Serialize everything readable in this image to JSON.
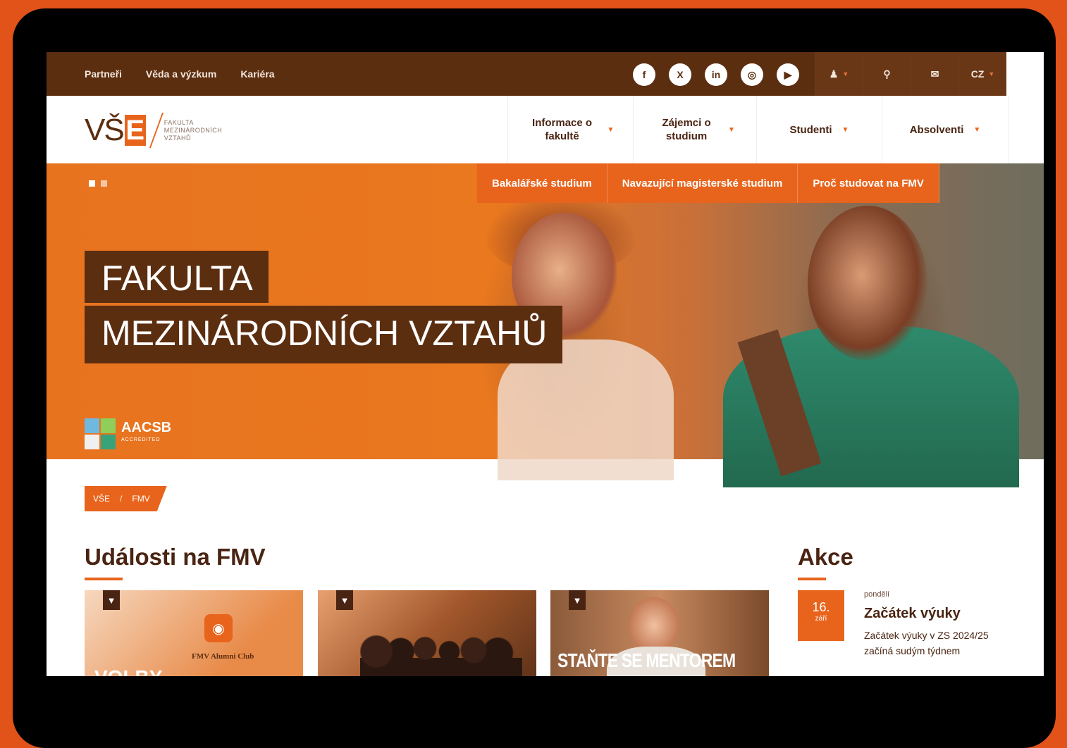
{
  "topbar": {
    "links": [
      "Partneři",
      "Věda a výzkum",
      "Kariéra"
    ],
    "social_icons": [
      "facebook-icon",
      "x-icon",
      "linkedin-icon",
      "instagram-icon",
      "youtube-icon"
    ],
    "social_glyphs": [
      "f",
      "X",
      "in",
      "◎",
      "▶"
    ],
    "language": "CZ"
  },
  "logo": {
    "vs": "VŠ",
    "e": "E",
    "subtitle_lines": [
      "FAKULTA",
      "MEZINÁRODNÍCH",
      "VZTAHŮ"
    ]
  },
  "nav": {
    "items": [
      {
        "label": "Informace o fakultě"
      },
      {
        "label": "Zájemci o studium"
      },
      {
        "label": "Studenti"
      },
      {
        "label": "Absolventi"
      }
    ]
  },
  "hero": {
    "quick_links": [
      "Bakalářské studium",
      "Navazující magisterské studium",
      "Proč studovat na FMV"
    ],
    "title_line1": "FAKULTA",
    "title_line2": "MEZINÁRODNÍCH VZTAHŮ",
    "aacsb_label": "AACSB",
    "aacsb_sub": "ACCREDITED",
    "slider_dots": 2,
    "active_dot": 1
  },
  "breadcrumb": [
    "VŠE",
    "FMV"
  ],
  "events_section": {
    "title": "Události na FMV",
    "cards": [
      {
        "club": "FMV Alumni Club",
        "overlay": "VOLBY"
      },
      {
        "overlay": ""
      },
      {
        "overlay": "STAŇTE SE MENTOREM"
      }
    ]
  },
  "akce": {
    "title": "Akce",
    "event": {
      "day_number": "16.",
      "month": "září",
      "weekday": "pondělí",
      "title": "Začátek výuky",
      "description": "Začátek výuky v ZS 2024/25 začíná sudým týdnem"
    }
  },
  "colors": {
    "brown": "#5c2e10",
    "orange": "#e8641d",
    "outer_bg": "#e2531a"
  }
}
